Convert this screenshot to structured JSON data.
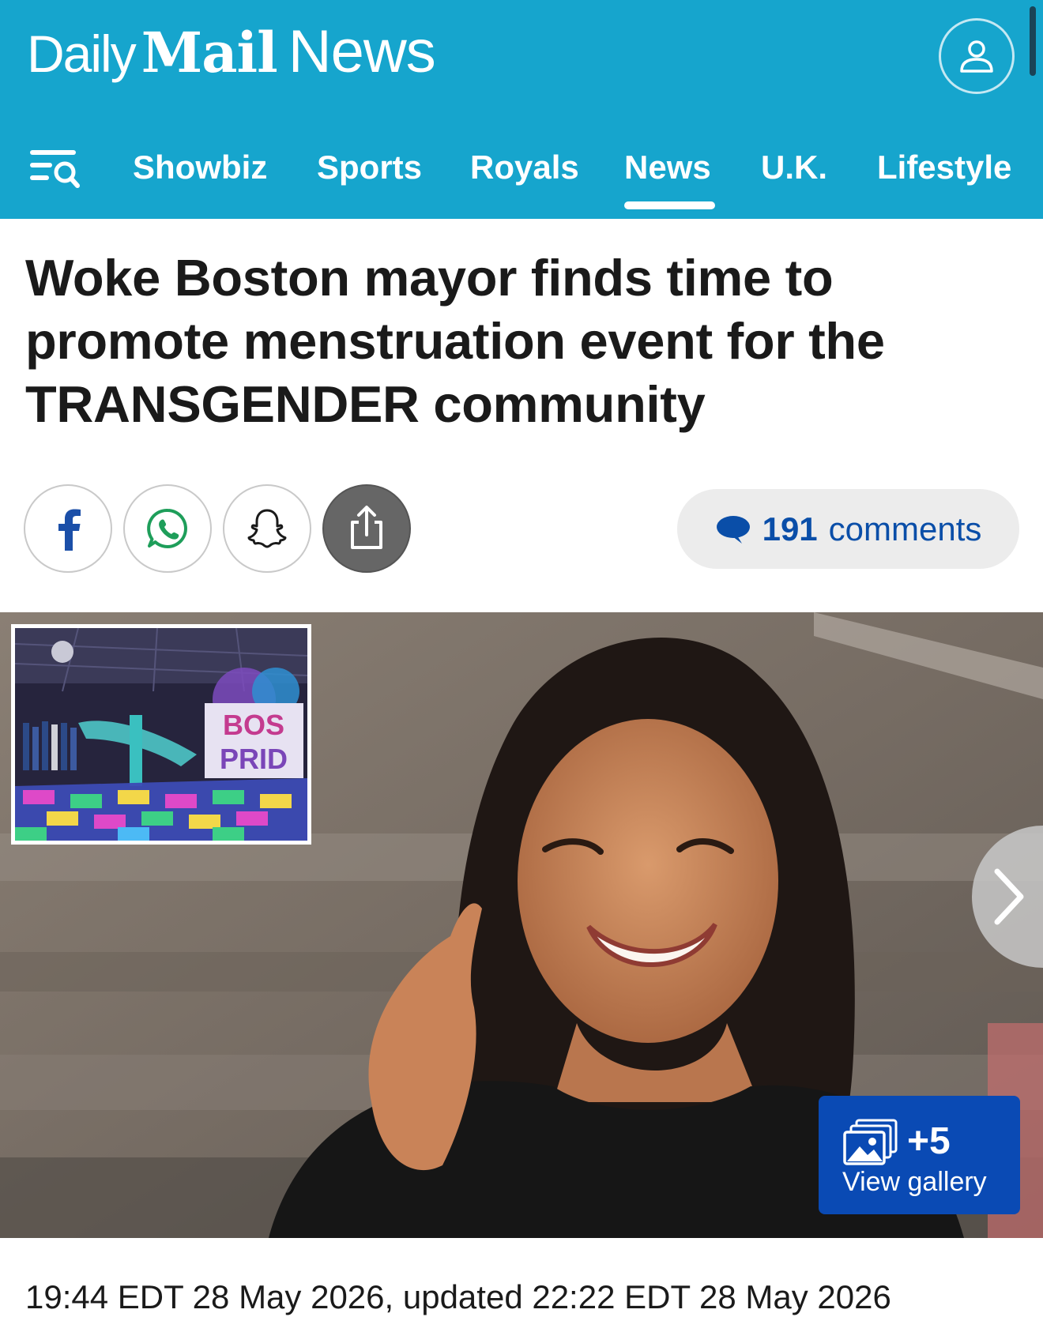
{
  "brand": {
    "daily": "Daily",
    "mail": "Mail",
    "news": "News"
  },
  "nav": {
    "items": [
      {
        "label": "Showbiz"
      },
      {
        "label": "Sports"
      },
      {
        "label": "Royals"
      },
      {
        "label": "News",
        "active": true
      },
      {
        "label": "U.K."
      },
      {
        "label": "Lifestyle"
      }
    ]
  },
  "article": {
    "headline": "Woke Boston mayor finds time to promote menstruation event for the TRANSGENDER community",
    "timestamp": "19:44 EDT 28 May 2026, updated 22:22 EDT 28 May 2026"
  },
  "share": {
    "buttons": [
      {
        "name": "facebook-icon"
      },
      {
        "name": "whatsapp-icon"
      },
      {
        "name": "snapchat-icon"
      },
      {
        "name": "share-icon"
      }
    ]
  },
  "comments": {
    "count": "191",
    "label": "comments"
  },
  "gallery": {
    "plus": "+5",
    "label": "View gallery"
  },
  "colors": {
    "header": "#16a5cd",
    "link": "#0a4ea8",
    "gallery_button": "#0a4ab4"
  }
}
